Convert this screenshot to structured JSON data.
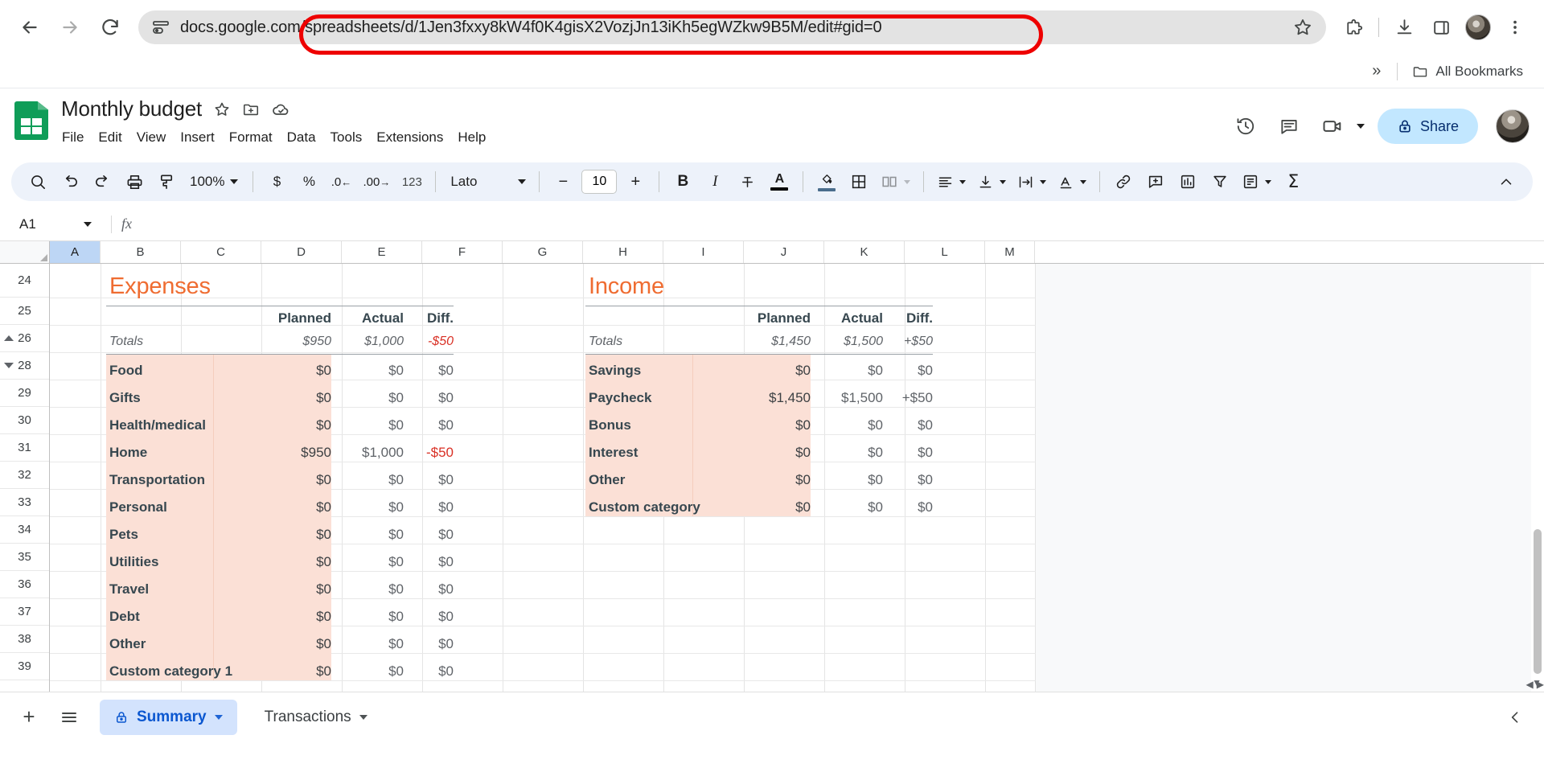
{
  "browser": {
    "back_label": "Back",
    "forward_label": "Forward",
    "reload_label": "Reload",
    "url": "docs.google.com/spreadsheets/d/1Jen3fxxy8kW4f0K4gisX2VozjJn13iKh5egWZkw9B5M/edit#gid=0",
    "url_domain": "docs.google.com",
    "url_path": "/spreadsheets/d/1Jen3fxxy8kW4f0K4gisX2VozjJn13iKh5egWZkw9B5M/edit#gid=0",
    "bookmarks": {
      "overflow_label": "»",
      "all_bookmarks_label": "All Bookmarks"
    },
    "highlight_color": "#ee0000"
  },
  "sheets": {
    "doc_title": "Monthly budget",
    "menu": [
      "File",
      "Edit",
      "View",
      "Insert",
      "Format",
      "Data",
      "Tools",
      "Extensions",
      "Help"
    ],
    "share_label": "Share",
    "toolbar": {
      "zoom": "100%",
      "percent_label": "%",
      "currency_label": "$",
      "decimal_dec_label": ".0",
      "decimal_inc_label": ".00",
      "format_123_label": "123",
      "font_name": "Lato",
      "font_size": "10",
      "bold_label": "B",
      "italic_label": "I",
      "minus_label": "−",
      "plus_label": "+",
      "text_color": "#000000",
      "fill_color": "#4a6d8c"
    },
    "name_box": "A1",
    "formula_value": "",
    "fx_label": "fx",
    "columns": [
      "A",
      "B",
      "C",
      "D",
      "E",
      "F",
      "G",
      "H",
      "I",
      "J",
      "K",
      "L",
      "M"
    ],
    "selected_column": "A",
    "rows": [
      "24",
      "25",
      "26",
      "28",
      "29",
      "30",
      "31",
      "32",
      "33",
      "34",
      "35",
      "36",
      "37",
      "38",
      "39"
    ],
    "tabs": [
      {
        "label": "Summary",
        "active": true,
        "locked": true
      },
      {
        "label": "Transactions",
        "active": false,
        "locked": false
      }
    ],
    "add_sheet_label": "+",
    "all_sheets_label": "≡"
  },
  "chart_data": {
    "type": "table",
    "title": "Monthly budget — Summary",
    "accent_color": "#ef6c31",
    "band_color": "#fbe0d6",
    "negative_color": "#d93025",
    "column_headers": [
      "",
      "Planned",
      "Actual",
      "Diff."
    ],
    "sections": [
      {
        "title": "Expenses",
        "totals_label": "Totals",
        "totals": {
          "planned": "$950",
          "actual": "$1,000",
          "diff": "-$50",
          "diff_sign": "negative"
        },
        "rows": [
          {
            "name": "Food",
            "planned": "$0",
            "actual": "$0",
            "diff": "$0",
            "diff_sign": "neutral"
          },
          {
            "name": "Gifts",
            "planned": "$0",
            "actual": "$0",
            "diff": "$0",
            "diff_sign": "neutral"
          },
          {
            "name": "Health/medical",
            "planned": "$0",
            "actual": "$0",
            "diff": "$0",
            "diff_sign": "neutral"
          },
          {
            "name": "Home",
            "planned": "$950",
            "actual": "$1,000",
            "diff": "-$50",
            "diff_sign": "negative"
          },
          {
            "name": "Transportation",
            "planned": "$0",
            "actual": "$0",
            "diff": "$0",
            "diff_sign": "neutral"
          },
          {
            "name": "Personal",
            "planned": "$0",
            "actual": "$0",
            "diff": "$0",
            "diff_sign": "neutral"
          },
          {
            "name": "Pets",
            "planned": "$0",
            "actual": "$0",
            "diff": "$0",
            "diff_sign": "neutral"
          },
          {
            "name": "Utilities",
            "planned": "$0",
            "actual": "$0",
            "diff": "$0",
            "diff_sign": "neutral"
          },
          {
            "name": "Travel",
            "planned": "$0",
            "actual": "$0",
            "diff": "$0",
            "diff_sign": "neutral"
          },
          {
            "name": "Debt",
            "planned": "$0",
            "actual": "$0",
            "diff": "$0",
            "diff_sign": "neutral"
          },
          {
            "name": "Other",
            "planned": "$0",
            "actual": "$0",
            "diff": "$0",
            "diff_sign": "neutral"
          },
          {
            "name": "Custom category 1",
            "planned": "$0",
            "actual": "$0",
            "diff": "$0",
            "diff_sign": "neutral"
          }
        ]
      },
      {
        "title": "Income",
        "totals_label": "Totals",
        "totals": {
          "planned": "$1,450",
          "actual": "$1,500",
          "diff": "+$50",
          "diff_sign": "positive"
        },
        "rows": [
          {
            "name": "Savings",
            "planned": "$0",
            "actual": "$0",
            "diff": "$0",
            "diff_sign": "neutral"
          },
          {
            "name": "Paycheck",
            "planned": "$1,450",
            "actual": "$1,500",
            "diff": "+$50",
            "diff_sign": "positive"
          },
          {
            "name": "Bonus",
            "planned": "$0",
            "actual": "$0",
            "diff": "$0",
            "diff_sign": "neutral"
          },
          {
            "name": "Interest",
            "planned": "$0",
            "actual": "$0",
            "diff": "$0",
            "diff_sign": "neutral"
          },
          {
            "name": "Other",
            "planned": "$0",
            "actual": "$0",
            "diff": "$0",
            "diff_sign": "neutral"
          },
          {
            "name": "Custom category",
            "planned": "$0",
            "actual": "$0",
            "diff": "$0",
            "diff_sign": "neutral"
          }
        ]
      }
    ]
  }
}
